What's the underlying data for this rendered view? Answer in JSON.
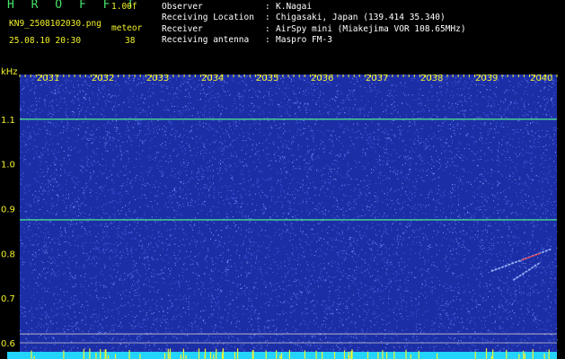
{
  "header": {
    "brand": "H R O F F T",
    "version": "1.00f",
    "filename": "KN9_2508102030.png",
    "kind": "meteor",
    "datetime": "25.08.10 20:30",
    "count": "38"
  },
  "meta": [
    {
      "label": "Observer",
      "value": "K.Nagai"
    },
    {
      "label": "Receiving Location",
      "value": "Chigasaki, Japan (139.414 35.340)"
    },
    {
      "label": "Receiver",
      "value": "AirSpy mini (Miakejima VOR 108.65MHz)"
    },
    {
      "label": "Receiving antenna",
      "value": "Maspro FM-3"
    }
  ],
  "chart_data": {
    "type": "heatmap",
    "ylabel": "kHz",
    "x_ticks": [
      "2031",
      "2032",
      "2033",
      "2034",
      "2035",
      "2036",
      "2037",
      "2038",
      "2039",
      "2040"
    ],
    "y_ticks": [
      "1.1",
      "1.0",
      "0.9",
      "0.8",
      "0.7",
      "0.6"
    ],
    "ylim": [
      0.58,
      1.2
    ],
    "xlim": [
      2030.5,
      2040.3
    ],
    "lines": [
      {
        "freq": 1.1,
        "kind": "carrier"
      },
      {
        "freq": 0.875,
        "kind": "carrier"
      },
      {
        "freq": 0.62,
        "kind": "reference"
      },
      {
        "freq": 0.6,
        "kind": "reference"
      }
    ],
    "echoes": [
      {
        "t_start": 2039.1,
        "t_end": 2040.2,
        "f_start": 0.76,
        "f_end": 0.81
      },
      {
        "t_start": 2039.5,
        "t_end": 2040.0,
        "f_start": 0.74,
        "f_end": 0.78
      }
    ],
    "colors": {
      "background": "#1c2ea6",
      "noise_hi": "#5a74ff",
      "carrier": "#4ae88a",
      "tick_text": "#f2f22a",
      "reference": "#c8c8c8",
      "bottom_bar": "#22d4ff",
      "spike": "#f2f22a"
    }
  }
}
